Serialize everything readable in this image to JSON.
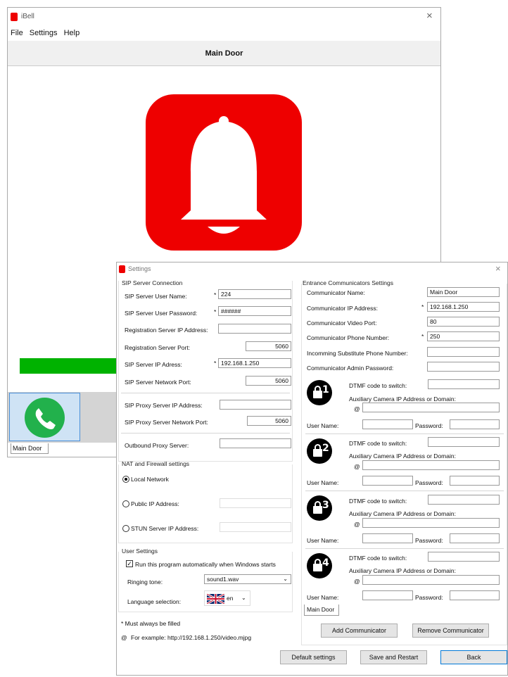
{
  "main_window": {
    "title": "iBell",
    "menu": [
      "File",
      "Settings",
      "Help"
    ],
    "door_header": "Main Door",
    "tab_label": "Main Door"
  },
  "settings": {
    "title": "Settings",
    "sip": {
      "section": "SIP Server Connection",
      "user_name_label": "SIP Server User Name:",
      "user_name": "224",
      "password_label": "SIP Server User Password:",
      "password": "######",
      "reg_ip_label": "Registration Server IP Address:",
      "reg_ip": "",
      "reg_port_label": "Registration Server Port:",
      "reg_port": "5060",
      "server_ip_label": "SIP Server IP Adress:",
      "server_ip": "192.168.1.250",
      "network_port_label": "SIP Server Network Port:",
      "network_port": "5060",
      "proxy_ip_label": "SIP Proxy Server IP Address:",
      "proxy_ip": "",
      "proxy_port_label": "SIP Proxy Server Network Port:",
      "proxy_port": "5060",
      "outbound_label": "Outbound Proxy Server:",
      "outbound": ""
    },
    "nat": {
      "section": "NAT and Firewall settings",
      "local": "Local Network",
      "public": "Public IP Address:",
      "stun": "STUN Server IP Address:"
    },
    "user": {
      "section": "User Settings",
      "autorun": "Run this program automatically when Windows starts",
      "ringing_label": "Ringing tone:",
      "ringing": "sound1.wav",
      "language_label": "Language selection:",
      "language": "en"
    },
    "notes": {
      "must": "* Must always be filled",
      "example": "For example:  http://192.168.1.250/video.mjpg"
    },
    "entrance": {
      "section": "Entrance Communicators Settings",
      "name_label": "Communicator Name:",
      "name": "Main Door",
      "ip_label": "Communicator IP Address:",
      "ip": "192.168.1.250",
      "video_port_label": "Communicator Video Port:",
      "video_port": "80",
      "phone_label": "Communicator Phone Number:",
      "phone": "250",
      "substitute_label": "Incomming Substitute Phone Number:",
      "admin_label": "Communicator Admin Password:",
      "dtmf_label": "DTMF code to switch:",
      "camera_label": "Auxiliary Camera IP Address or Domain:",
      "username_label": "User Name:",
      "password_label": "Password:",
      "locks": [
        "1",
        "2",
        "3",
        "4"
      ],
      "tab_label": "Main Door",
      "add_btn": "Add Communicator",
      "remove_btn": "Remove Communicator"
    },
    "buttons": {
      "default": "Default settings",
      "save": "Save and Restart",
      "back": "Back"
    },
    "star": "*",
    "at": "@",
    "close": "×"
  },
  "colors": {
    "brand_red": "#ee0000",
    "call_green": "#22b14c",
    "progress_green": "#00b200"
  }
}
